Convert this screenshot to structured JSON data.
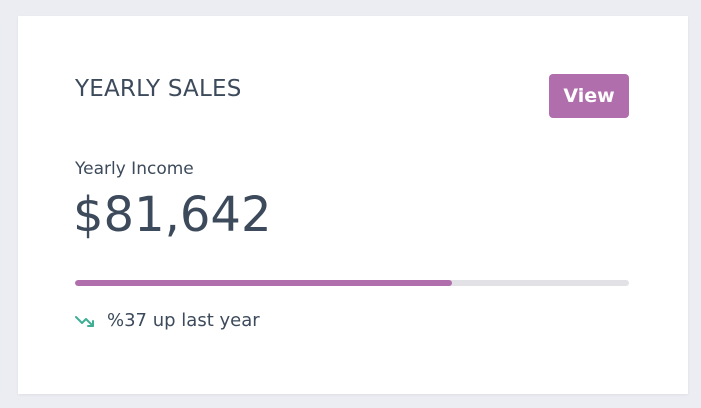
{
  "card": {
    "title": "YEARLY SALES",
    "view_label": "View",
    "income_label": "Yearly Income",
    "income_value": "$81,642",
    "progress_percent": 68,
    "trend_text": "%37 up last year",
    "trend_icon": "trending-down-icon"
  },
  "colors": {
    "accent": "#b06fac",
    "text": "#3c4a5b",
    "trend": "#3fae95",
    "track": "#e2e2e6",
    "background": "#ecedf3"
  }
}
